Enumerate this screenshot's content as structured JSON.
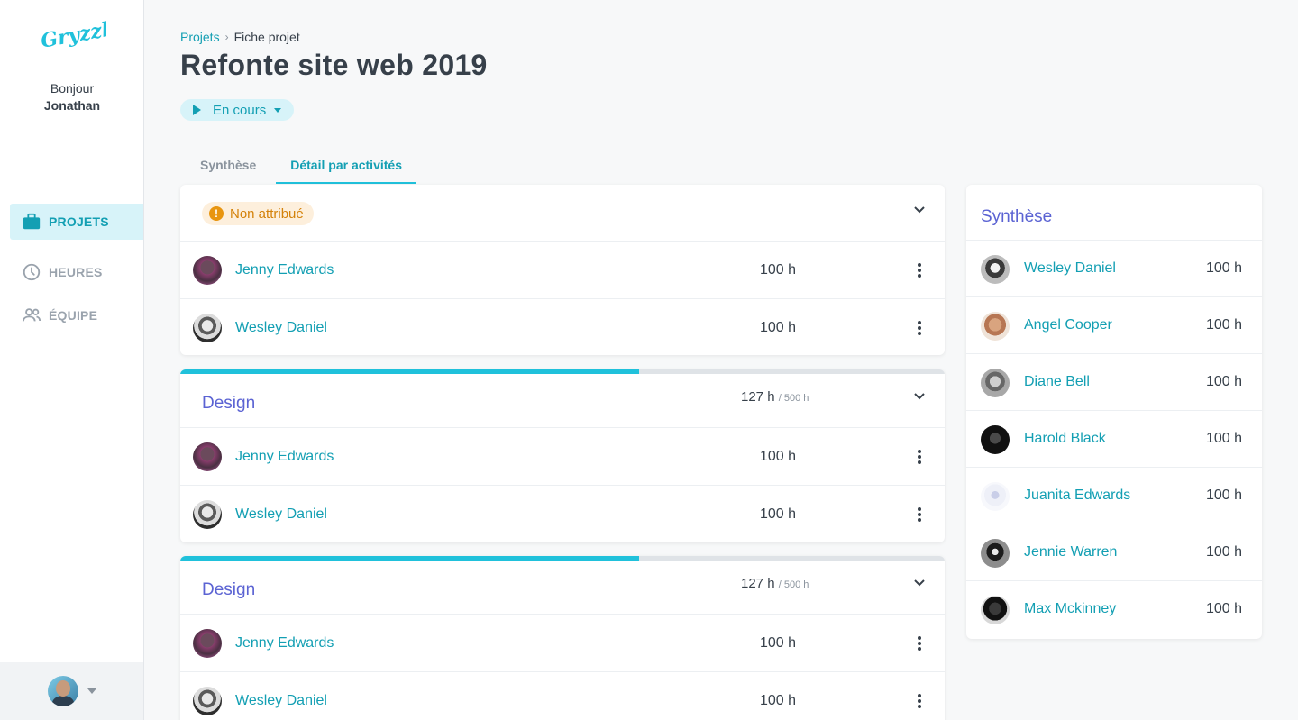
{
  "app": {
    "logo_text": "Gryzzly"
  },
  "sidebar": {
    "greeting": "Bonjour",
    "user_name": "Jonathan",
    "nav": [
      {
        "label": "PROJETS",
        "icon": "briefcase-icon",
        "active": true
      },
      {
        "label": "HEURES",
        "icon": "clock-icon",
        "active": false
      },
      {
        "label": "ÉQUIPE",
        "icon": "team-icon",
        "active": false
      }
    ]
  },
  "header": {
    "breadcrumb_link": "Projets",
    "breadcrumb_current": "Fiche projet",
    "title": "Refonte site web 2019",
    "status": "En cours"
  },
  "tabs": [
    {
      "label": "Synthèse",
      "active": false
    },
    {
      "label": "Détail par activités",
      "active": true
    }
  ],
  "activities": [
    {
      "badge": "Non attribué",
      "rows": [
        {
          "name": "Jenny Edwards",
          "hours": "100 h"
        },
        {
          "name": "Wesley Daniel",
          "hours": "100 h"
        }
      ]
    },
    {
      "title": "Design",
      "hours": "127 h",
      "budget": "/ 500 h",
      "progress": 0.6,
      "rows": [
        {
          "name": "Jenny Edwards",
          "hours": "100 h"
        },
        {
          "name": "Wesley Daniel",
          "hours": "100 h"
        }
      ]
    },
    {
      "title": "Design",
      "hours": "127 h",
      "budget": "/ 500 h",
      "progress": 0.6,
      "rows": [
        {
          "name": "Jenny Edwards",
          "hours": "100 h"
        },
        {
          "name": "Wesley Daniel",
          "hours": "100 h"
        }
      ]
    }
  ],
  "summary": {
    "title": "Synthèse",
    "rows": [
      {
        "name": "Wesley Daniel",
        "hours": "100 h"
      },
      {
        "name": "Angel Cooper",
        "hours": "100 h"
      },
      {
        "name": "Diane Bell",
        "hours": "100 h"
      },
      {
        "name": "Harold Black",
        "hours": "100 h"
      },
      {
        "name": "Juanita Edwards",
        "hours": "100 h"
      },
      {
        "name": "Jennie Warren",
        "hours": "100 h"
      },
      {
        "name": "Max Mckinney",
        "hours": "100 h"
      }
    ]
  },
  "colors": {
    "accent": "#20c1db",
    "link": "#139fb3",
    "activity_title": "#5b63d3",
    "warning": "#e8950f"
  }
}
